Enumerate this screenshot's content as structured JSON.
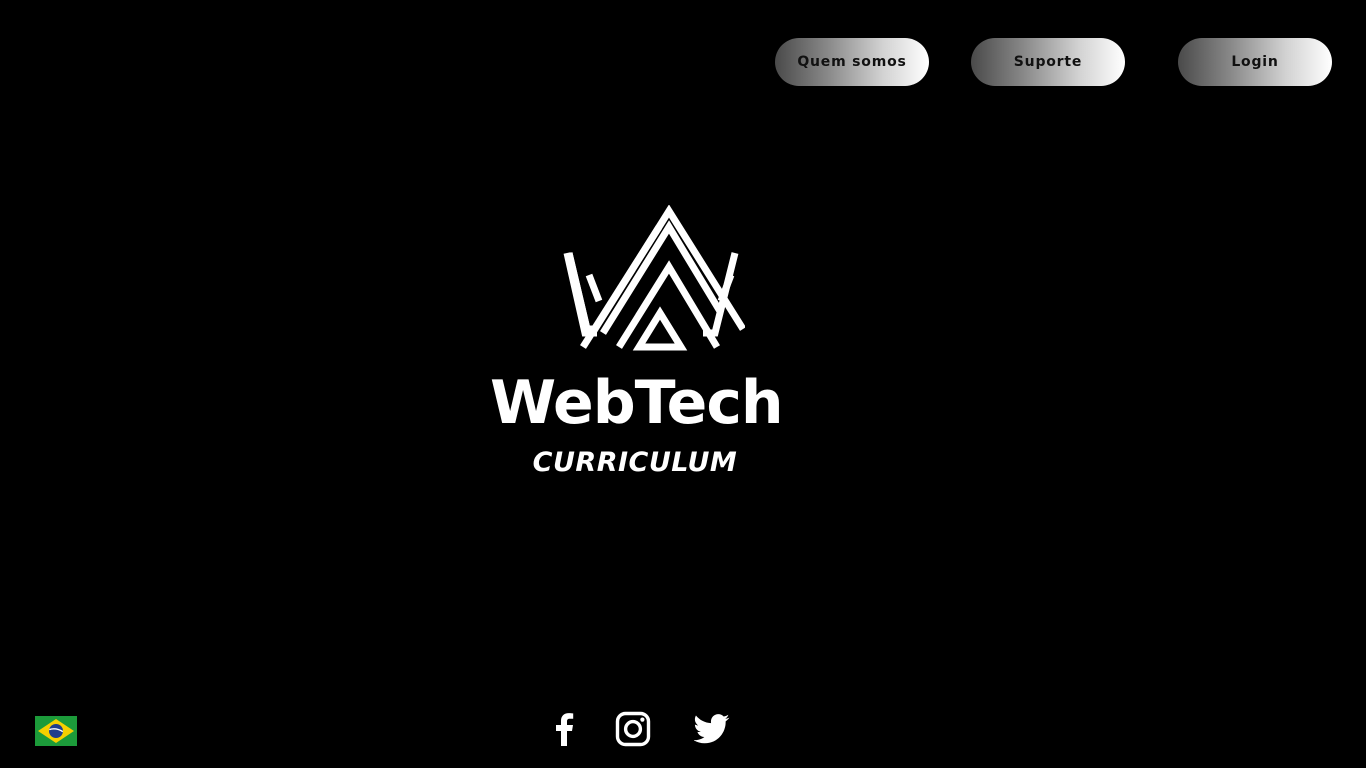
{
  "nav": {
    "about_label": "Quem somos",
    "support_label": "Suporte",
    "login_label": "Login"
  },
  "brand": {
    "title": "WebTech",
    "subtitle": "CURRICULUM"
  },
  "language": {
    "flag_icon": "brazil-flag-icon"
  },
  "social": {
    "icons": [
      "facebook-icon",
      "instagram-icon",
      "twitter-icon"
    ]
  },
  "colors": {
    "background": "#000000",
    "button_gradient_start": "#4a4a4a",
    "button_gradient_end": "#ffffff",
    "foreground": "#ffffff"
  }
}
